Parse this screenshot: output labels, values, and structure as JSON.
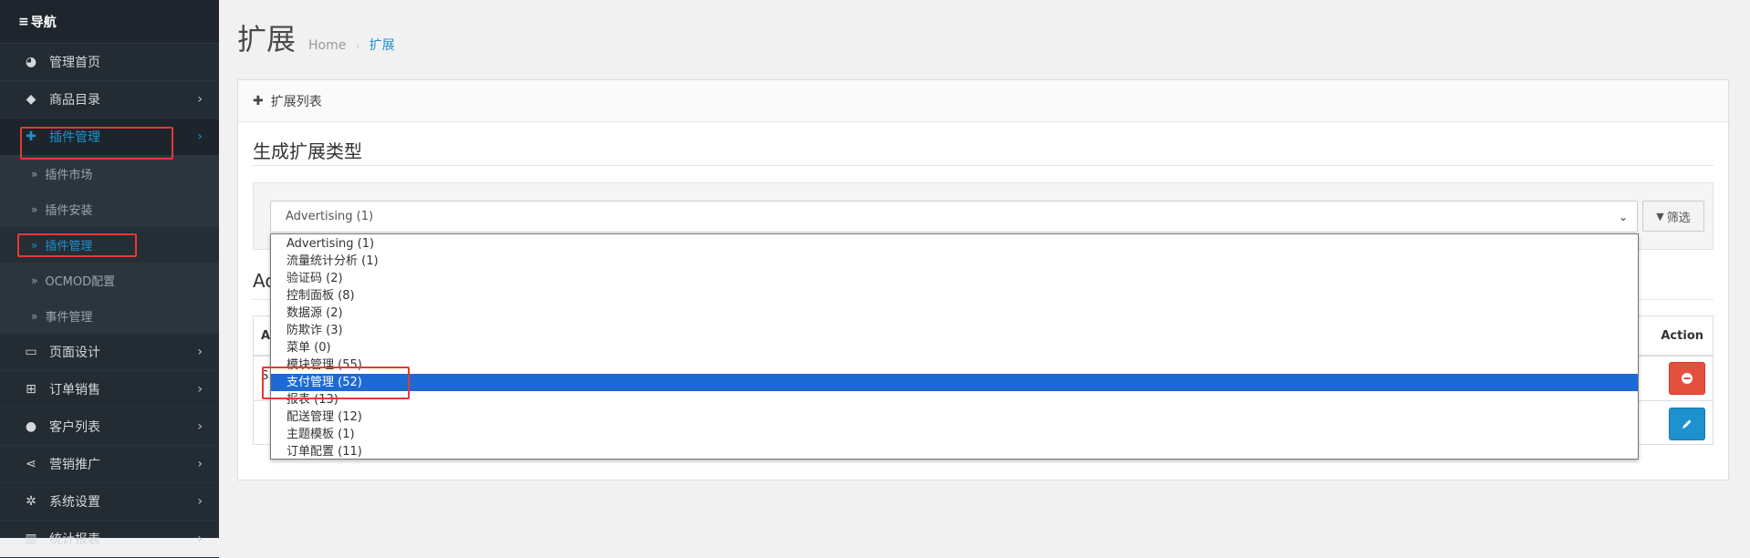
{
  "sidebar": {
    "header": "导航",
    "items": [
      {
        "label": "管理首页",
        "icon": "dashboard-icon",
        "arrow": false
      },
      {
        "label": "商品目录",
        "icon": "tags-icon",
        "arrow": true
      },
      {
        "label": "插件管理",
        "icon": "puzzle-icon",
        "arrow": true,
        "active": true
      },
      {
        "label": "页面设计",
        "icon": "monitor-icon",
        "arrow": true
      },
      {
        "label": "订单销售",
        "icon": "cart-icon",
        "arrow": true
      },
      {
        "label": "客户列表",
        "icon": "user-icon",
        "arrow": true
      },
      {
        "label": "营销推广",
        "icon": "share-icon",
        "arrow": true
      },
      {
        "label": "系统设置",
        "icon": "gear-icon",
        "arrow": true
      },
      {
        "label": "统计报表",
        "icon": "chart-icon",
        "arrow": true
      }
    ],
    "subitems": [
      {
        "label": "插件市场"
      },
      {
        "label": "插件安装"
      },
      {
        "label": "插件管理",
        "active": true
      },
      {
        "label": "OCMOD配置"
      },
      {
        "label": "事件管理"
      }
    ]
  },
  "header": {
    "title": "扩展",
    "breadcrumb": [
      "Home",
      "扩展"
    ]
  },
  "panel": {
    "heading": "扩展列表",
    "section_title": "生成扩展类型",
    "select_value": "Advertising (1)",
    "filter_label": "筛选",
    "subsection_stub": "Ac",
    "table": {
      "left_header_stub": "Ad",
      "action_header": "Action",
      "row_stub": "S"
    }
  },
  "dropdown": {
    "options": [
      "Advertising (1)",
      "流量统计分析 (1)",
      "验证码 (2)",
      "控制面板 (8)",
      "数据源 (2)",
      "防欺诈 (3)",
      "菜单 (0)",
      "模块管理 (55)",
      "支付管理 (52)",
      "报表 (13)",
      "配送管理 (12)",
      "主题模板 (1)",
      "订单配置 (11)"
    ],
    "selected_index": 8
  },
  "colors": {
    "accent": "#1e91cf",
    "sidebar_bg": "#232b33",
    "danger": "#e3503e",
    "highlight": "#1e6ad5",
    "annotation": "#e53935"
  }
}
